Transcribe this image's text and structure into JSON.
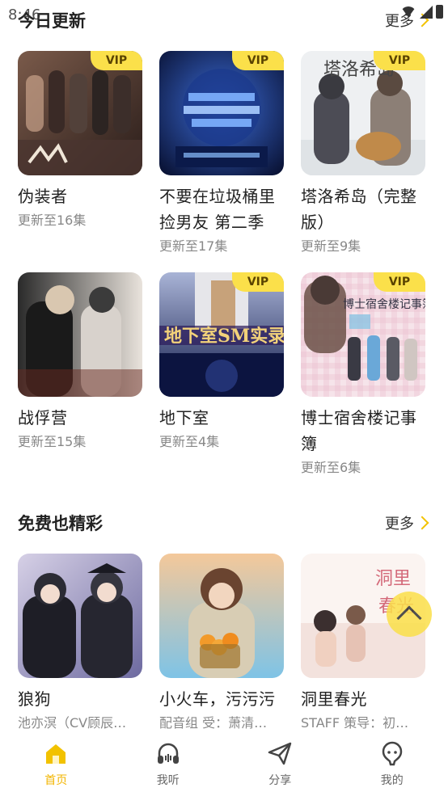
{
  "status": {
    "time": "8:46"
  },
  "sections": [
    {
      "title": "今日更新",
      "more": "更多",
      "items": [
        {
          "title": "伪装者",
          "sub": "更新至16集",
          "vip": "VIP"
        },
        {
          "title": "不要在垃圾桶里捡男友 第二季",
          "sub": "更新至17集",
          "vip": "VIP"
        },
        {
          "title": "塔洛希岛（完整版）",
          "sub": "更新至9集",
          "vip": "VIP"
        },
        {
          "title": "战俘营",
          "sub": "更新至15集",
          "vip": ""
        },
        {
          "title": "地下室",
          "sub": "更新至4集",
          "vip": "VIP"
        },
        {
          "title": "博士宿舍楼记事簿",
          "sub": "更新至6集",
          "vip": "VIP"
        }
      ]
    },
    {
      "title": "免费也精彩",
      "more": "更多",
      "items": [
        {
          "title": "狼狗",
          "sub": "池亦溟（CV顾辰…",
          "vip": ""
        },
        {
          "title": "小火车，污污污",
          "sub": "配音组 受：萧清…",
          "vip": ""
        },
        {
          "title": "洞里春光",
          "sub": "STAFF 策导：初…",
          "vip": ""
        }
      ]
    }
  ],
  "nav": [
    {
      "label": "首页",
      "icon": "home-icon",
      "active": true
    },
    {
      "label": "我听",
      "icon": "headphones-icon",
      "active": false
    },
    {
      "label": "分享",
      "icon": "send-icon",
      "active": false
    },
    {
      "label": "我的",
      "icon": "profile-icon",
      "active": false
    }
  ],
  "colors": {
    "accent": "#fbe04a",
    "active_nav": "#f2b500"
  }
}
